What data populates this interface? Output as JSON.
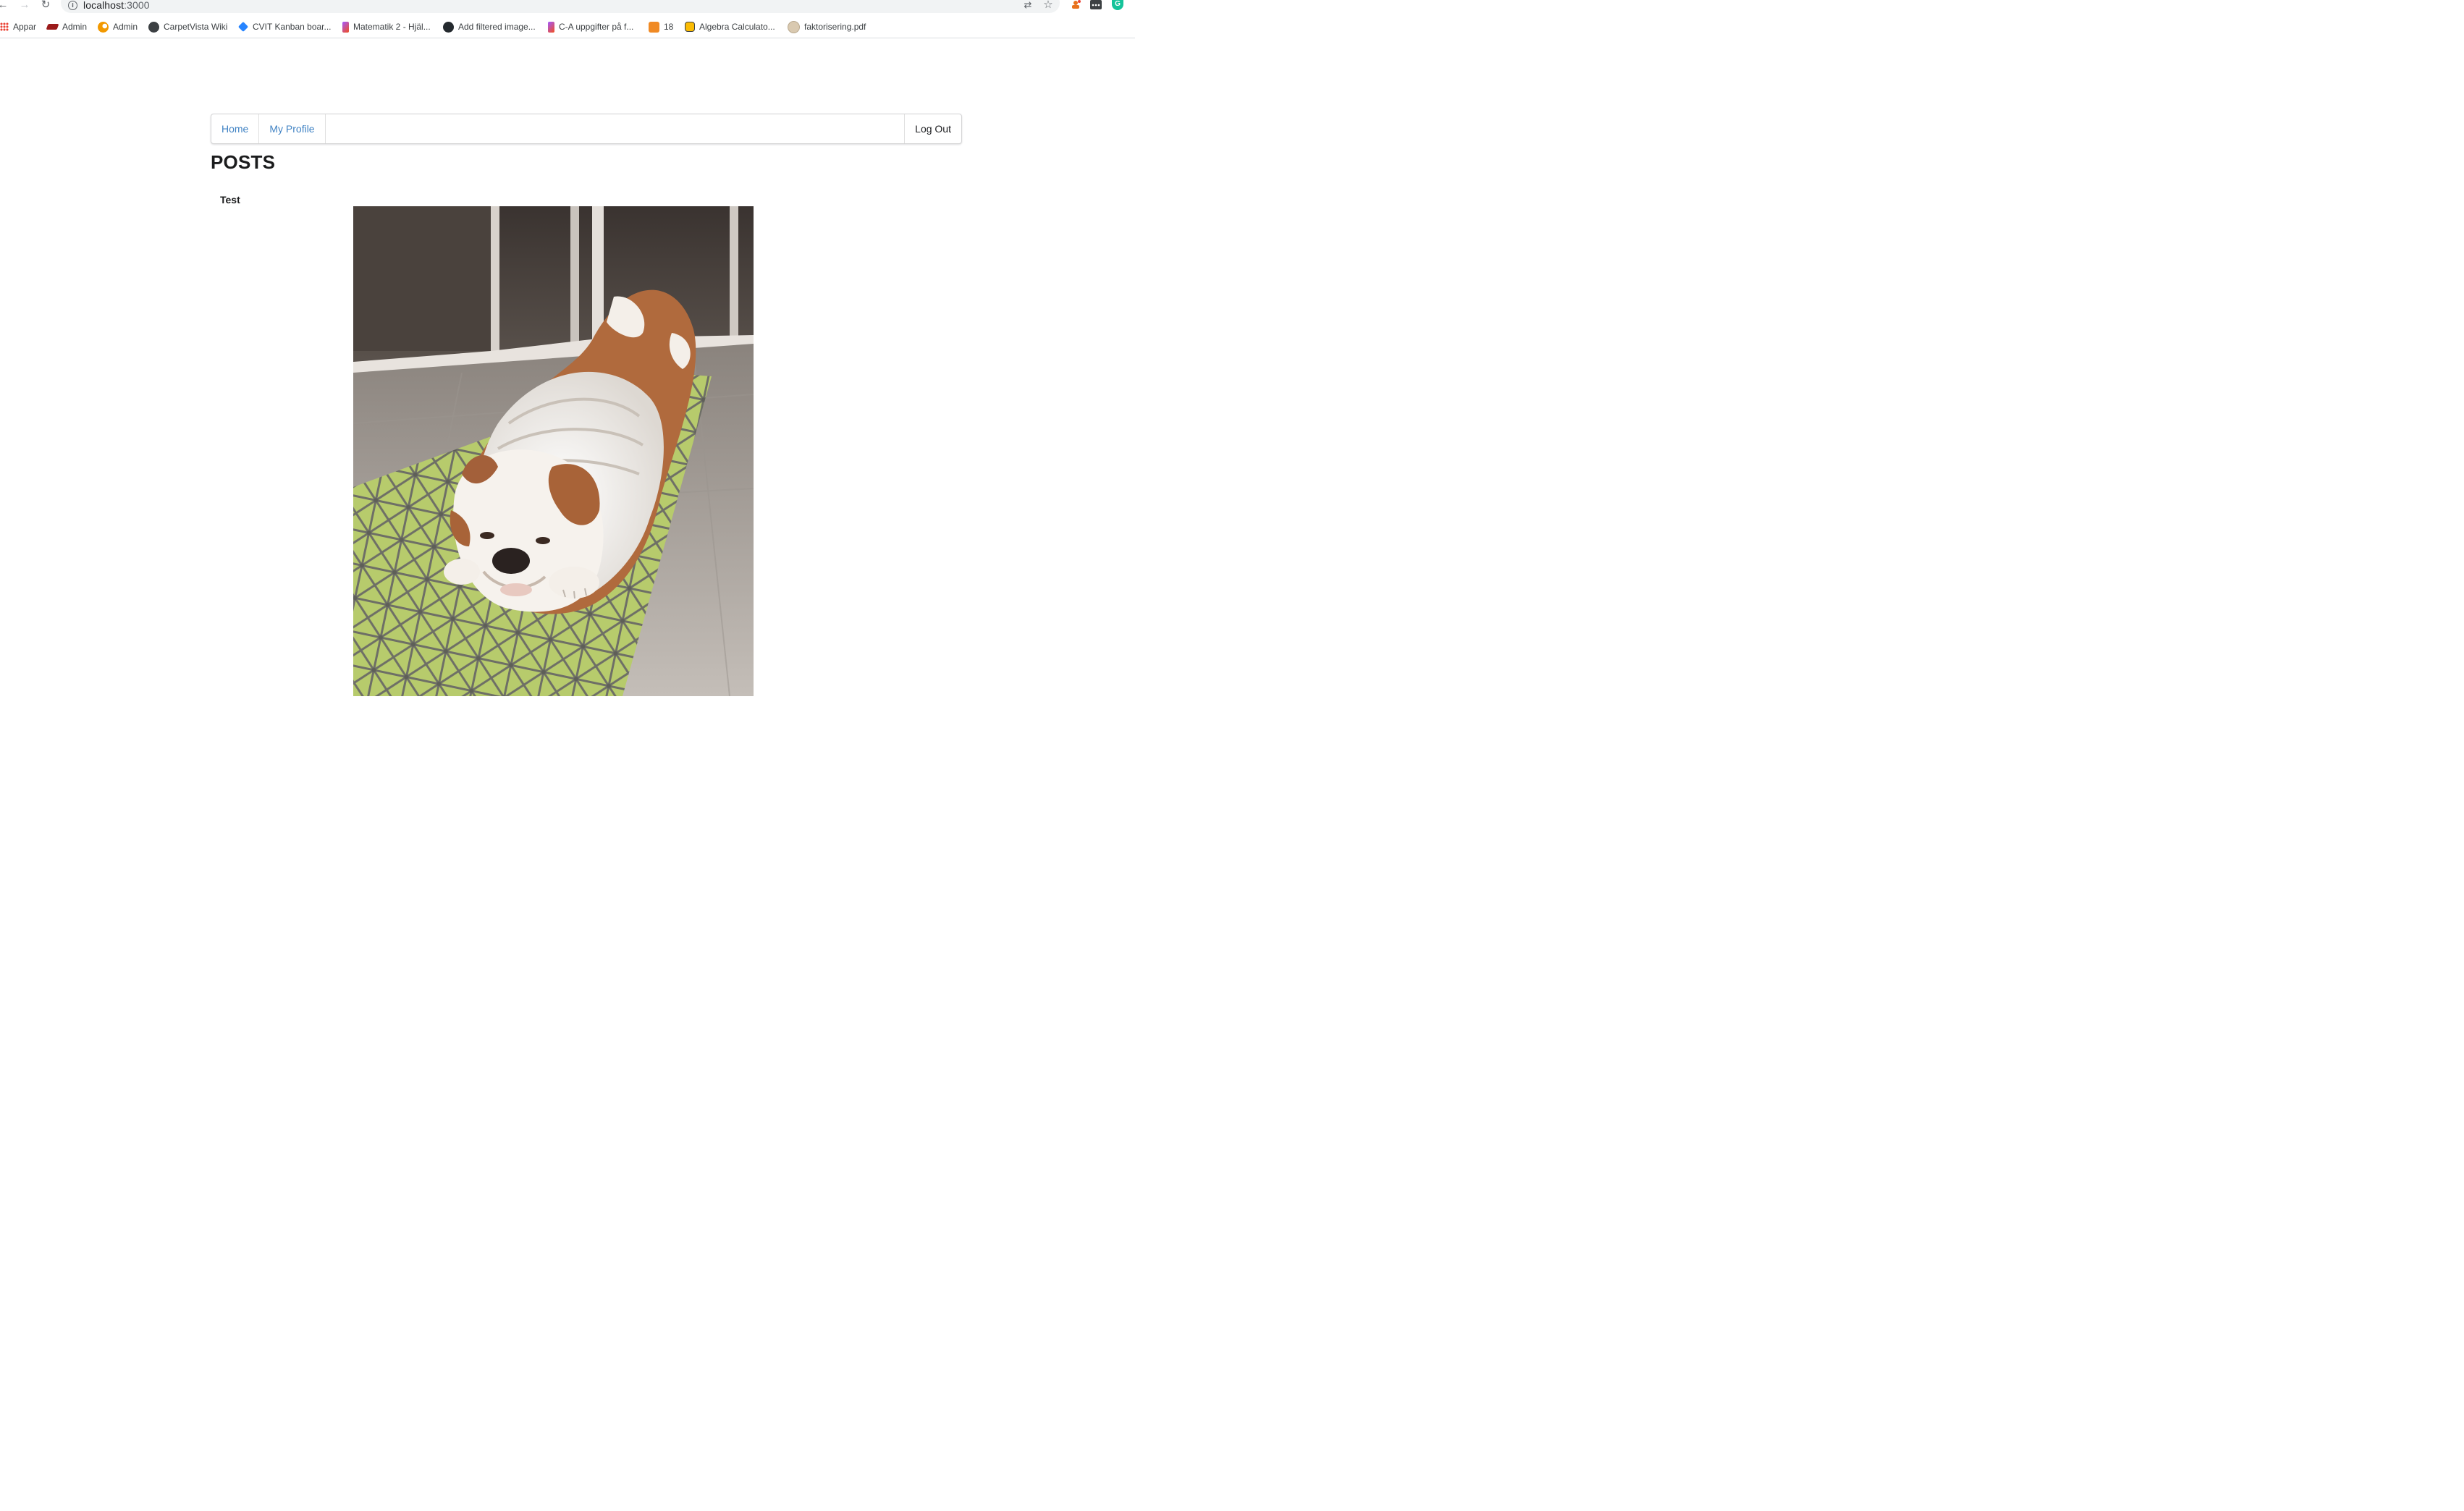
{
  "browser": {
    "url_host": "localhost",
    "url_port": ":3000",
    "back_glyph": "←",
    "forward_glyph": "→",
    "reload_glyph": "↻",
    "info_glyph": "i",
    "star_glyph": "☆",
    "translate_glyph": "⇄",
    "grammarly_glyph": "G",
    "icons": [
      "back-arrow-icon",
      "forward-arrow-icon",
      "reload-icon",
      "info-icon",
      "translate-icon",
      "star-icon",
      "extension-icon",
      "grammarly-icon"
    ]
  },
  "bookmarks": [
    {
      "label": "Appar",
      "icon": "apps-grid-icon"
    },
    {
      "label": "Admin",
      "icon": "admin-red-icon"
    },
    {
      "label": "Admin",
      "icon": "admin-orange-icon"
    },
    {
      "label": "CarpetVista Wiki",
      "icon": "globe-icon"
    },
    {
      "label": "CVIT Kanban boar...",
      "icon": "jira-icon"
    },
    {
      "label": "Matematik 2 - Hjäl...",
      "icon": "figma-icon"
    },
    {
      "label": "Add filtered image...",
      "icon": "github-icon"
    },
    {
      "label": "C-A uppgifter på f...",
      "icon": "figma-icon"
    },
    {
      "label": "18",
      "icon": "box-icon"
    },
    {
      "label": "Algebra Calculato...",
      "icon": "calculator-icon"
    },
    {
      "label": "faktorisering.pdf",
      "icon": "pdf-icon"
    }
  ],
  "nav": {
    "home": "Home",
    "profile": "My Profile",
    "logout": "Log Out"
  },
  "page": {
    "title": "POSTS"
  },
  "posts": [
    {
      "title": "Test",
      "image": "photo of an English bulldog lying on a green patterned mat on a tiled floor"
    }
  ],
  "colors": {
    "link": "#4183c4",
    "text": "#1b1c1d",
    "mat": "#b5c96a",
    "floor": "#b7b0a9"
  }
}
